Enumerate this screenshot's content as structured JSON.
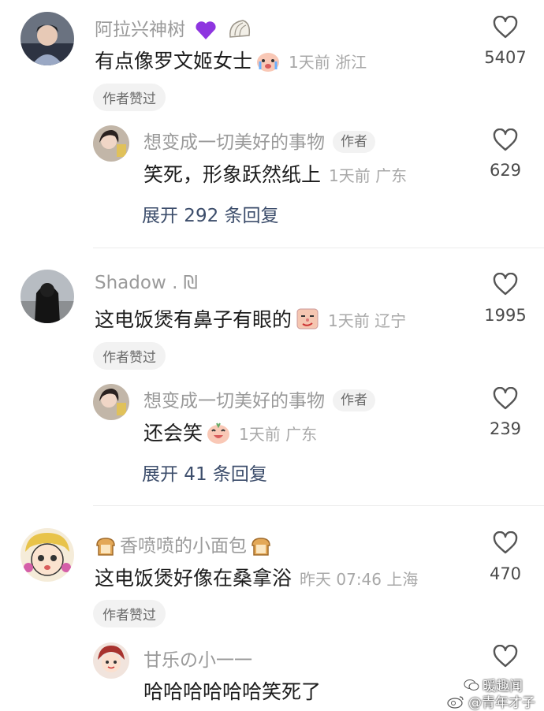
{
  "comments": [
    {
      "username": "阿拉兴神树",
      "text": "有点像罗文姬女士",
      "meta": "1天前 浙江",
      "likes": "5407",
      "badge": "作者赞过",
      "reply": {
        "username": "想变成一切美好的事物",
        "author_tag": "作者",
        "text": "笑死，形象跃然纸上",
        "meta": "1天前 广东",
        "likes": "629"
      },
      "expand": "展开 292 条回复"
    },
    {
      "username": "Shadow . ₪",
      "text": "这电饭煲有鼻子有眼的",
      "meta": "1天前 辽宁",
      "likes": "1995",
      "badge": "作者赞过",
      "reply": {
        "username": "想变成一切美好的事物",
        "author_tag": "作者",
        "text": "还会笑",
        "meta": "1天前 广东",
        "likes": "239"
      },
      "expand": "展开 41 条回复"
    },
    {
      "username": "香喷喷的小面包",
      "text": "这电饭煲好像在桑拿浴",
      "meta": "昨天 07:46 上海",
      "likes": "470",
      "badge": "作者赞过",
      "reply": {
        "username": "甘乐の小一一",
        "text": "哈哈哈哈哈哈笑死了"
      }
    }
  ],
  "watermark": {
    "line1": "暖趣闻",
    "line2": "@青年才子"
  },
  "colors": {
    "accent_link": "#3c4d6b",
    "heart_stroke": "#555555",
    "gray_text": "#9a9a9a"
  }
}
